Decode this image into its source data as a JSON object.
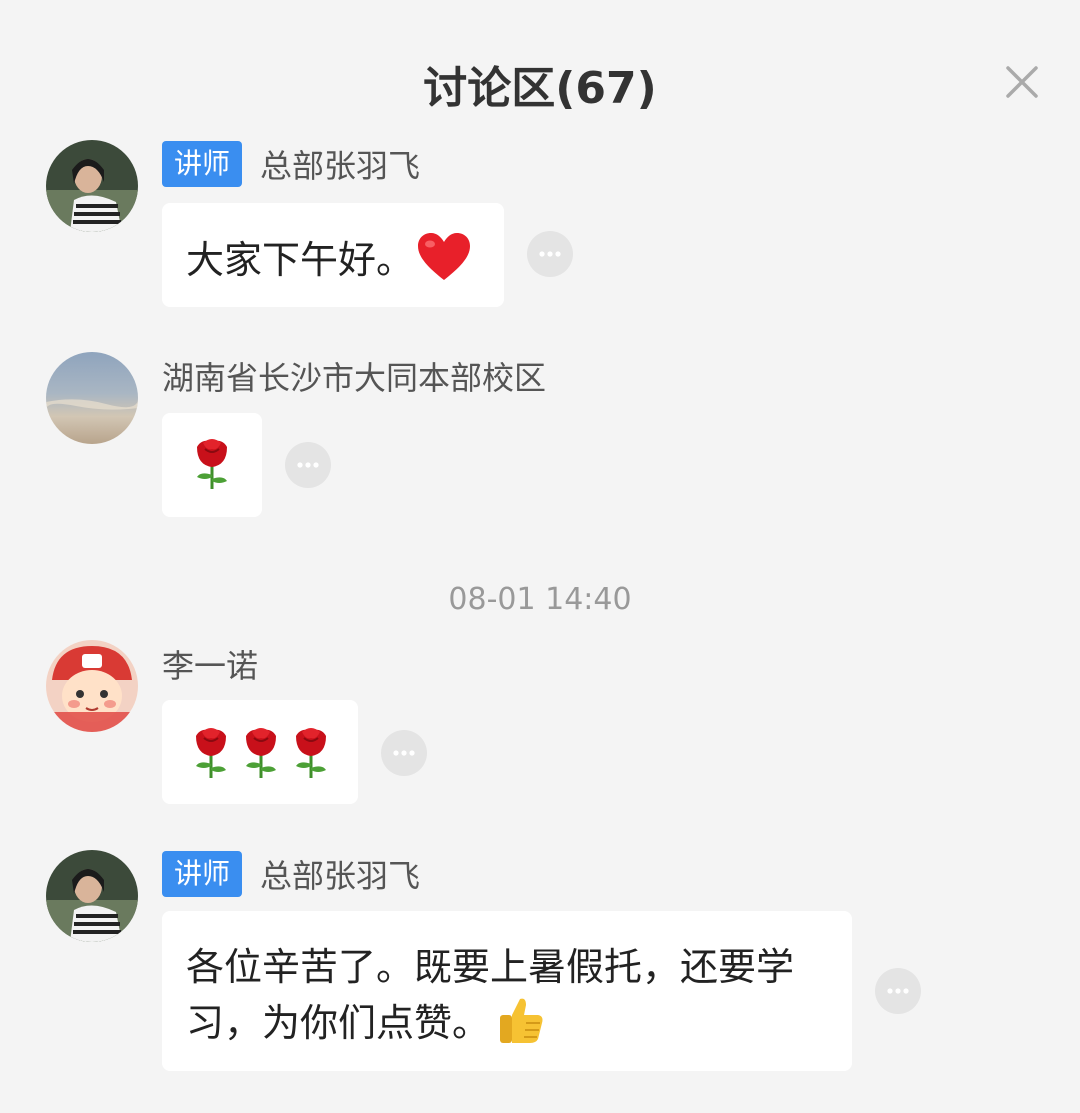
{
  "header": {
    "title": "讨论区(67)"
  },
  "messages": [
    {
      "badge": "讲师",
      "sender": "总部张羽飞",
      "text": "大家下午好。",
      "emoji": "heart-icon"
    },
    {
      "sender": "湖南省长沙市大同本部校区",
      "emoji": "rose-icon",
      "emoji_count": 1
    },
    {
      "sender": "李一诺",
      "emoji": "rose-icon",
      "emoji_count": 3
    },
    {
      "badge": "讲师",
      "sender": "总部张羽飞",
      "text_line1": "各位辛苦了。既要上暑假托，还要学",
      "text_line2": "习，为你们点赞。",
      "emoji": "thumbs-up-icon"
    }
  ],
  "timestamp": "08-01 14:40",
  "colors": {
    "background": "#f4f4f4",
    "badge": "#3a8ef0",
    "bubble": "#ffffff",
    "more_button": "#e4e4e4",
    "timestamp": "#999999",
    "heart": "#e8202a",
    "rose": "#c8101a"
  }
}
